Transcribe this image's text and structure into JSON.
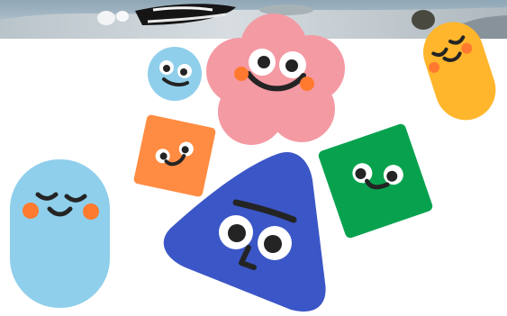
{
  "colors": {
    "background": "#ffffff",
    "photo_sky": "#9fb4c2",
    "photo_ground": "#dfe3e6",
    "pink_flower": "#f49aa3",
    "light_blue": "#8fcfeb",
    "orange": "#ff8c42",
    "green": "#08a24e",
    "blue_triangle": "#3b56c6",
    "yellow": "#ffb62c",
    "cheek_orange": "#ff7a2f",
    "face_dark": "#242424"
  },
  "icons": [
    "photo-strip",
    "pink-flower-character",
    "light-blue-circle-character",
    "orange-square-character",
    "green-square-character",
    "blue-triangle-character",
    "light-blue-pill-character",
    "yellow-pill-character"
  ]
}
